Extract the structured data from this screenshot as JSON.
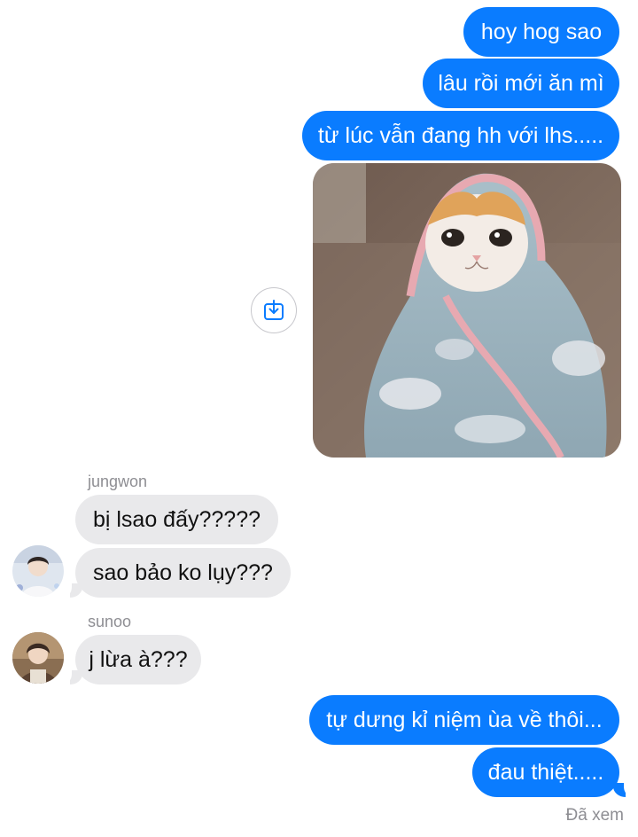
{
  "messages_outgoing_top": [
    {
      "text": "hoy hog sao"
    },
    {
      "text": "lâu rồi mới ăn mì"
    },
    {
      "text": "từ lúc vẫn đang hh với lhs....."
    }
  ],
  "image_message": {
    "description_icon": "save-to-photos-icon"
  },
  "jungwon": {
    "name": "jungwon",
    "messages": [
      "bị lsao đấy?????",
      "sao bảo ko lụy???"
    ]
  },
  "sunoo": {
    "name": "sunoo",
    "messages": [
      "j lừa à???"
    ]
  },
  "messages_outgoing_bottom": [
    {
      "text": "tự dưng kỉ niệm ùa về thôi..."
    },
    {
      "text": "đau thiệt....."
    }
  ],
  "status": {
    "seen": "Đã xem"
  },
  "colors": {
    "outgoing_bubble": "#0a7cff",
    "incoming_bubble": "#e9e9eb",
    "meta_text": "#8e8e93"
  }
}
